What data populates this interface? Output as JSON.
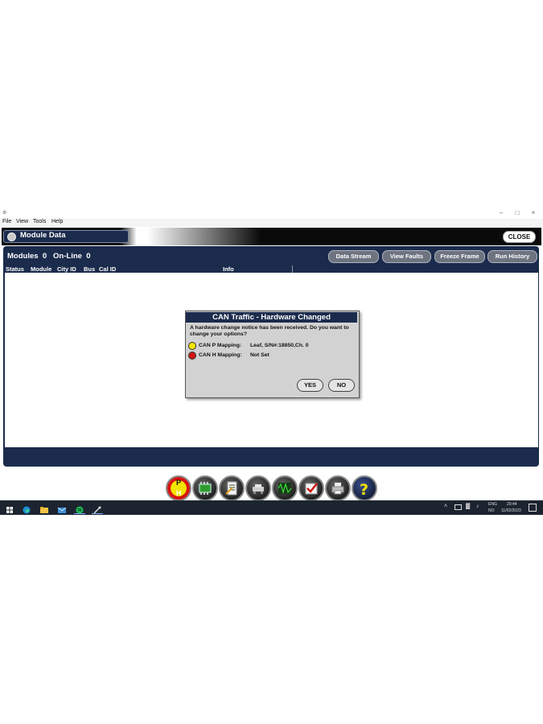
{
  "window": {
    "title": "",
    "menu": [
      "File",
      "View",
      "Tools",
      "Help"
    ]
  },
  "header": {
    "title": "Module Data",
    "close_label": "CLOSE"
  },
  "summary": {
    "modules_label": "Modules",
    "modules_count": "0",
    "online_label": "On-Line",
    "online_count": "0"
  },
  "toolbar": {
    "data_stream": "Data Stream",
    "view_faults": "View Faults",
    "freeze_frame": "Freeze Frame",
    "run_history": "Run History"
  },
  "table": {
    "columns": [
      "Status",
      "Module",
      "City ID",
      "Bus",
      "Cal ID",
      "Info"
    ],
    "rows": []
  },
  "dialog": {
    "title": "CAN Traffic - Hardware Changed",
    "message": "A hardware change notice has been received.  Do you want to change your options?",
    "mappings": [
      {
        "label": "CAN P Mapping:",
        "value": "Leaf, S/N#:18850,Ch. 0",
        "status_color": "#f2e600"
      },
      {
        "label": "CAN H Mapping:",
        "value": "Not Set",
        "status_color": "#d11414"
      }
    ],
    "yes_label": "YES",
    "no_label": "NO"
  },
  "function_bar": {
    "ph_top": "P",
    "ph_bottom": "H",
    "icons": [
      "ph-icon",
      "module-chip-icon",
      "checklist-icon",
      "vehicle-icon",
      "waveform-icon",
      "checkmark-icon",
      "printer-icon",
      "help-icon"
    ]
  },
  "taskbar": {
    "lang_top": "ENG",
    "lang_bottom": "NO",
    "time": "20:44",
    "date": "11/02/2023"
  },
  "colors": {
    "navy": "#1b2b4c",
    "button_gray": "#6e7380",
    "dialog_gray": "#d2d2d2"
  }
}
